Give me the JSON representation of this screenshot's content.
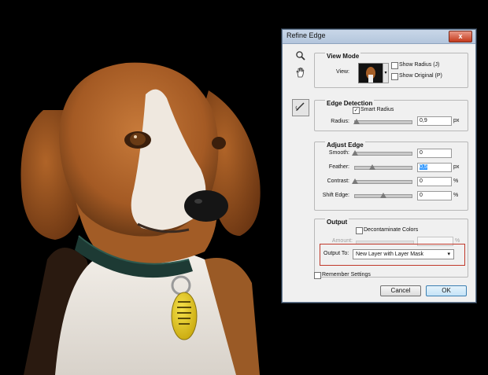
{
  "dialog": {
    "title": "Refine Edge",
    "close_symbol": "x"
  },
  "tools": [
    {
      "name": "zoom-tool",
      "icon": "magnifier-icon"
    },
    {
      "name": "hand-tool",
      "icon": "hand-icon"
    },
    {
      "name": "refine-radius-brush",
      "icon": "brush-icon"
    }
  ],
  "view_mode": {
    "title": "View Mode",
    "view_label": "View:",
    "show_radius": {
      "label": "Show Radius (J)",
      "checked": false
    },
    "show_original": {
      "label": "Show Original (P)",
      "checked": false
    }
  },
  "edge_detection": {
    "title": "Edge Detection",
    "smart_radius": {
      "label": "Smart Radius",
      "checked": true
    },
    "radius": {
      "label": "Radius:",
      "value": "0,9",
      "unit": "px",
      "level": 0.03
    }
  },
  "adjust_edge": {
    "title": "Adjust Edge",
    "smooth": {
      "label": "Smooth:",
      "value": "0",
      "unit": "",
      "level": 0.0
    },
    "feather": {
      "label": "Feather:",
      "value": "0,5",
      "unit": "px",
      "level": 0.3
    },
    "contrast": {
      "label": "Contrast:",
      "value": "0",
      "unit": "%",
      "level": 0.0
    },
    "shift_edge": {
      "label": "Shift Edge:",
      "value": "0",
      "unit": "%",
      "level": 0.5
    }
  },
  "output": {
    "title": "Output",
    "decontaminate": {
      "label": "Decontaminate Colors",
      "checked": false
    },
    "amount": {
      "label": "Amount:",
      "value": "",
      "unit": "%"
    },
    "output_to_label": "Output To:",
    "output_to_value": "New Layer with Layer Mask"
  },
  "remember_settings": {
    "label": "Remember Settings",
    "checked": false
  },
  "buttons": {
    "cancel": "Cancel",
    "ok": "OK"
  },
  "colors": {
    "background": "#000000",
    "highlight_border": "#c0392b",
    "selection": "#3399ff"
  }
}
